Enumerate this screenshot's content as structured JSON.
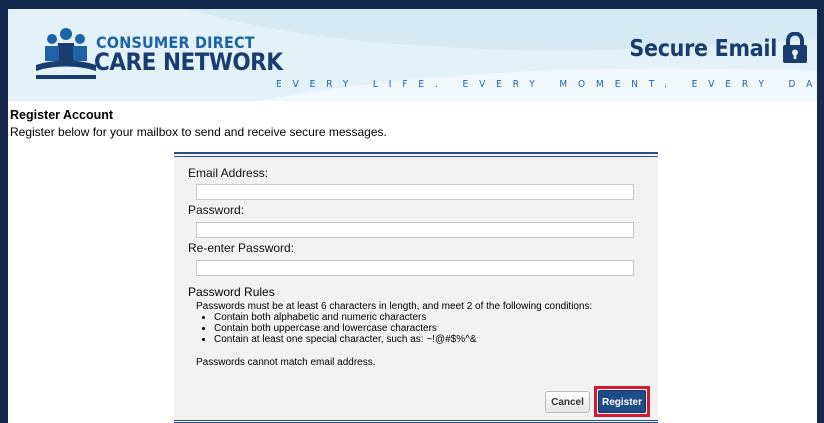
{
  "header": {
    "logo_line1": "CONSUMER DIRECT",
    "logo_line2": "CARE NETWORK",
    "product_title": "Secure Email",
    "tagline": "EVERY LIFE. EVERY MOMENT. EVERY DAY."
  },
  "page": {
    "title": "Register Account",
    "subtitle": "Register below for your mailbox to send and receive secure messages."
  },
  "form": {
    "email_label": "Email Address:",
    "email_value": "",
    "password_label": "Password:",
    "password_value": "",
    "reenter_label": "Re-enter Password:",
    "reenter_value": "",
    "rules_title": "Password Rules",
    "rules_intro": "Passwords must be at least 6 characters in length, and meet 2 of the following conditions:",
    "rules": [
      "Contain both alphabetic and numeric characters",
      "Contain both uppercase and lowercase characters",
      "Contain at least one special character, such as: ~!@#$%^&"
    ],
    "rules_note": "Passwords cannot match email address.",
    "cancel_label": "Cancel",
    "register_label": "Register"
  },
  "colors": {
    "frame": "#13284d",
    "brand_blue": "#1e62a8",
    "brand_navy": "#1a3c6e",
    "card_rule": "#28528a",
    "register_button": "#1e4c86",
    "highlight": "#d6192f"
  },
  "icons": {
    "logo": "people-group-icon",
    "lock": "lock-icon"
  }
}
